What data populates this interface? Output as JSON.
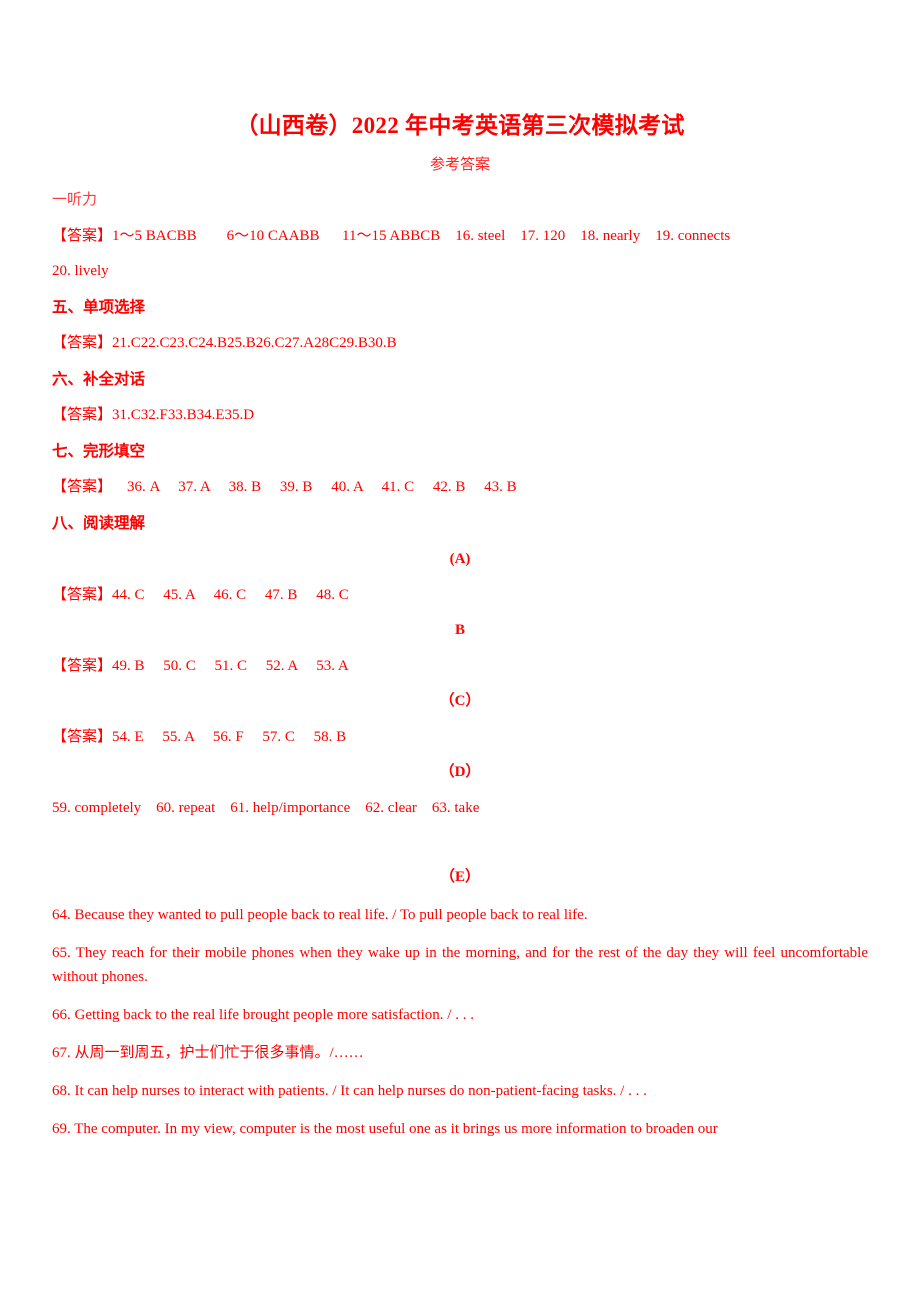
{
  "document": {
    "title": "（山西卷）2022 年中考英语第三次模拟考试",
    "subtitle": "参考答案",
    "accent_color": "#ff0000"
  },
  "sections": {
    "listening": {
      "heading": "一听力",
      "answer_line_1": "【答案】1～5 BACBB        6～10 CAABB      11～15 ABBCB    16. steel    17. 120    18. nearly    19. connects",
      "answer_line_2": "20. lively"
    },
    "multiple_choice": {
      "heading": "五、单项选择",
      "answer_line": "【答案】21.C22.C23.C24.B25.B26.C27.A28C29.B30.B"
    },
    "complete_dialogue": {
      "heading": "六、补全对话",
      "answer_line": "【答案】31.C32.F33.B34.E35.D"
    },
    "cloze": {
      "heading": "七、完形填空",
      "answer_line": "【答案】    36. A     37. A     38. B     39. B     40. A     41. C     42. B     43. B"
    },
    "reading": {
      "heading": "八、阅读理解",
      "passages": [
        {
          "label": "(A)",
          "answer_line": "【答案】44. C     45. A     46. C     47. B     48. C"
        },
        {
          "label": "B",
          "answer_line": "【答案】49. B     50. C     51. C     52. A     53. A"
        },
        {
          "label": "（C）",
          "answer_line": "【答案】54. E     55. A     56. F     57. C     58. B"
        },
        {
          "label": "（D）",
          "answer_line": "59. completely    60. repeat    61. help/importance    62. clear    63. take"
        }
      ],
      "passage_e": {
        "label": "（E）",
        "items": [
          "64. Because they wanted to pull people back to real life. / To pull people back to real life.",
          "65. They reach for their mobile phones when they wake up in the morning, and for the rest of the day they will feel uncomfortable without phones.",
          "66. Getting back to the real life brought people more satisfaction. / . . .",
          "67.  从周一到周五，护士们忙于很多事情。/……",
          "68. It can help nurses to interact with patients. / It can help nurses do non-patient-facing tasks. / . . .",
          "69. The computer. In my view, computer is the most useful one as it brings us more information to broaden our"
        ]
      }
    }
  }
}
